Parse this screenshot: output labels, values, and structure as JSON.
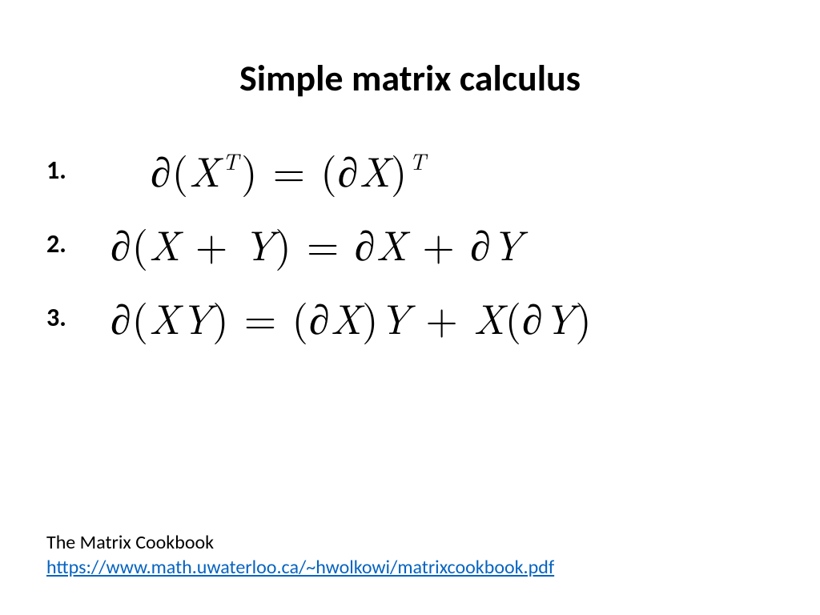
{
  "title": "Simple matrix calculus",
  "items": [
    {
      "num": "1.",
      "eq_html": "<span class='ital'>∂</span><span class='op'>(</span><span class='ital'>X</span><span class='sup'>T</span><span class='op'>)</span> <span class='op'>=</span> <span class='op'>(</span><span class='ital'>∂X</span><span class='op'>)</span><span class='sup'>T</span>",
      "eq_text": "∂(Xᵀ) = (∂X)ᵀ"
    },
    {
      "num": "2.",
      "eq_html": "<span class='ital'>∂</span><span class='op'>(</span><span class='ital'>X</span> <span class='op'>+</span> <span class='ital'>Y</span><span class='op'>)</span> <span class='op'>=</span> <span class='ital'>∂X</span> <span class='op'>+</span> <span class='ital'>∂Y</span>",
      "eq_text": "∂(X + Y) = ∂X + ∂Y"
    },
    {
      "num": "3.",
      "eq_html": "<span class='ital'>∂</span><span class='op'>(</span><span class='ital'>XY</span><span class='op'>)</span> <span class='op'>=</span> <span class='op'>(</span><span class='ital'>∂X</span><span class='op'>)</span><span class='ital'>Y</span> <span class='op'>+</span> <span class='ital'>X</span><span class='op'>(</span><span class='ital'>∂Y</span><span class='op'>)</span>",
      "eq_text": "∂(XY) = (∂X)Y + X(∂Y)"
    }
  ],
  "footer": {
    "ref": "The Matrix Cookbook",
    "url": "https://www.math.uwaterloo.ca/~hwolkowi/matrixcookbook.pdf"
  }
}
